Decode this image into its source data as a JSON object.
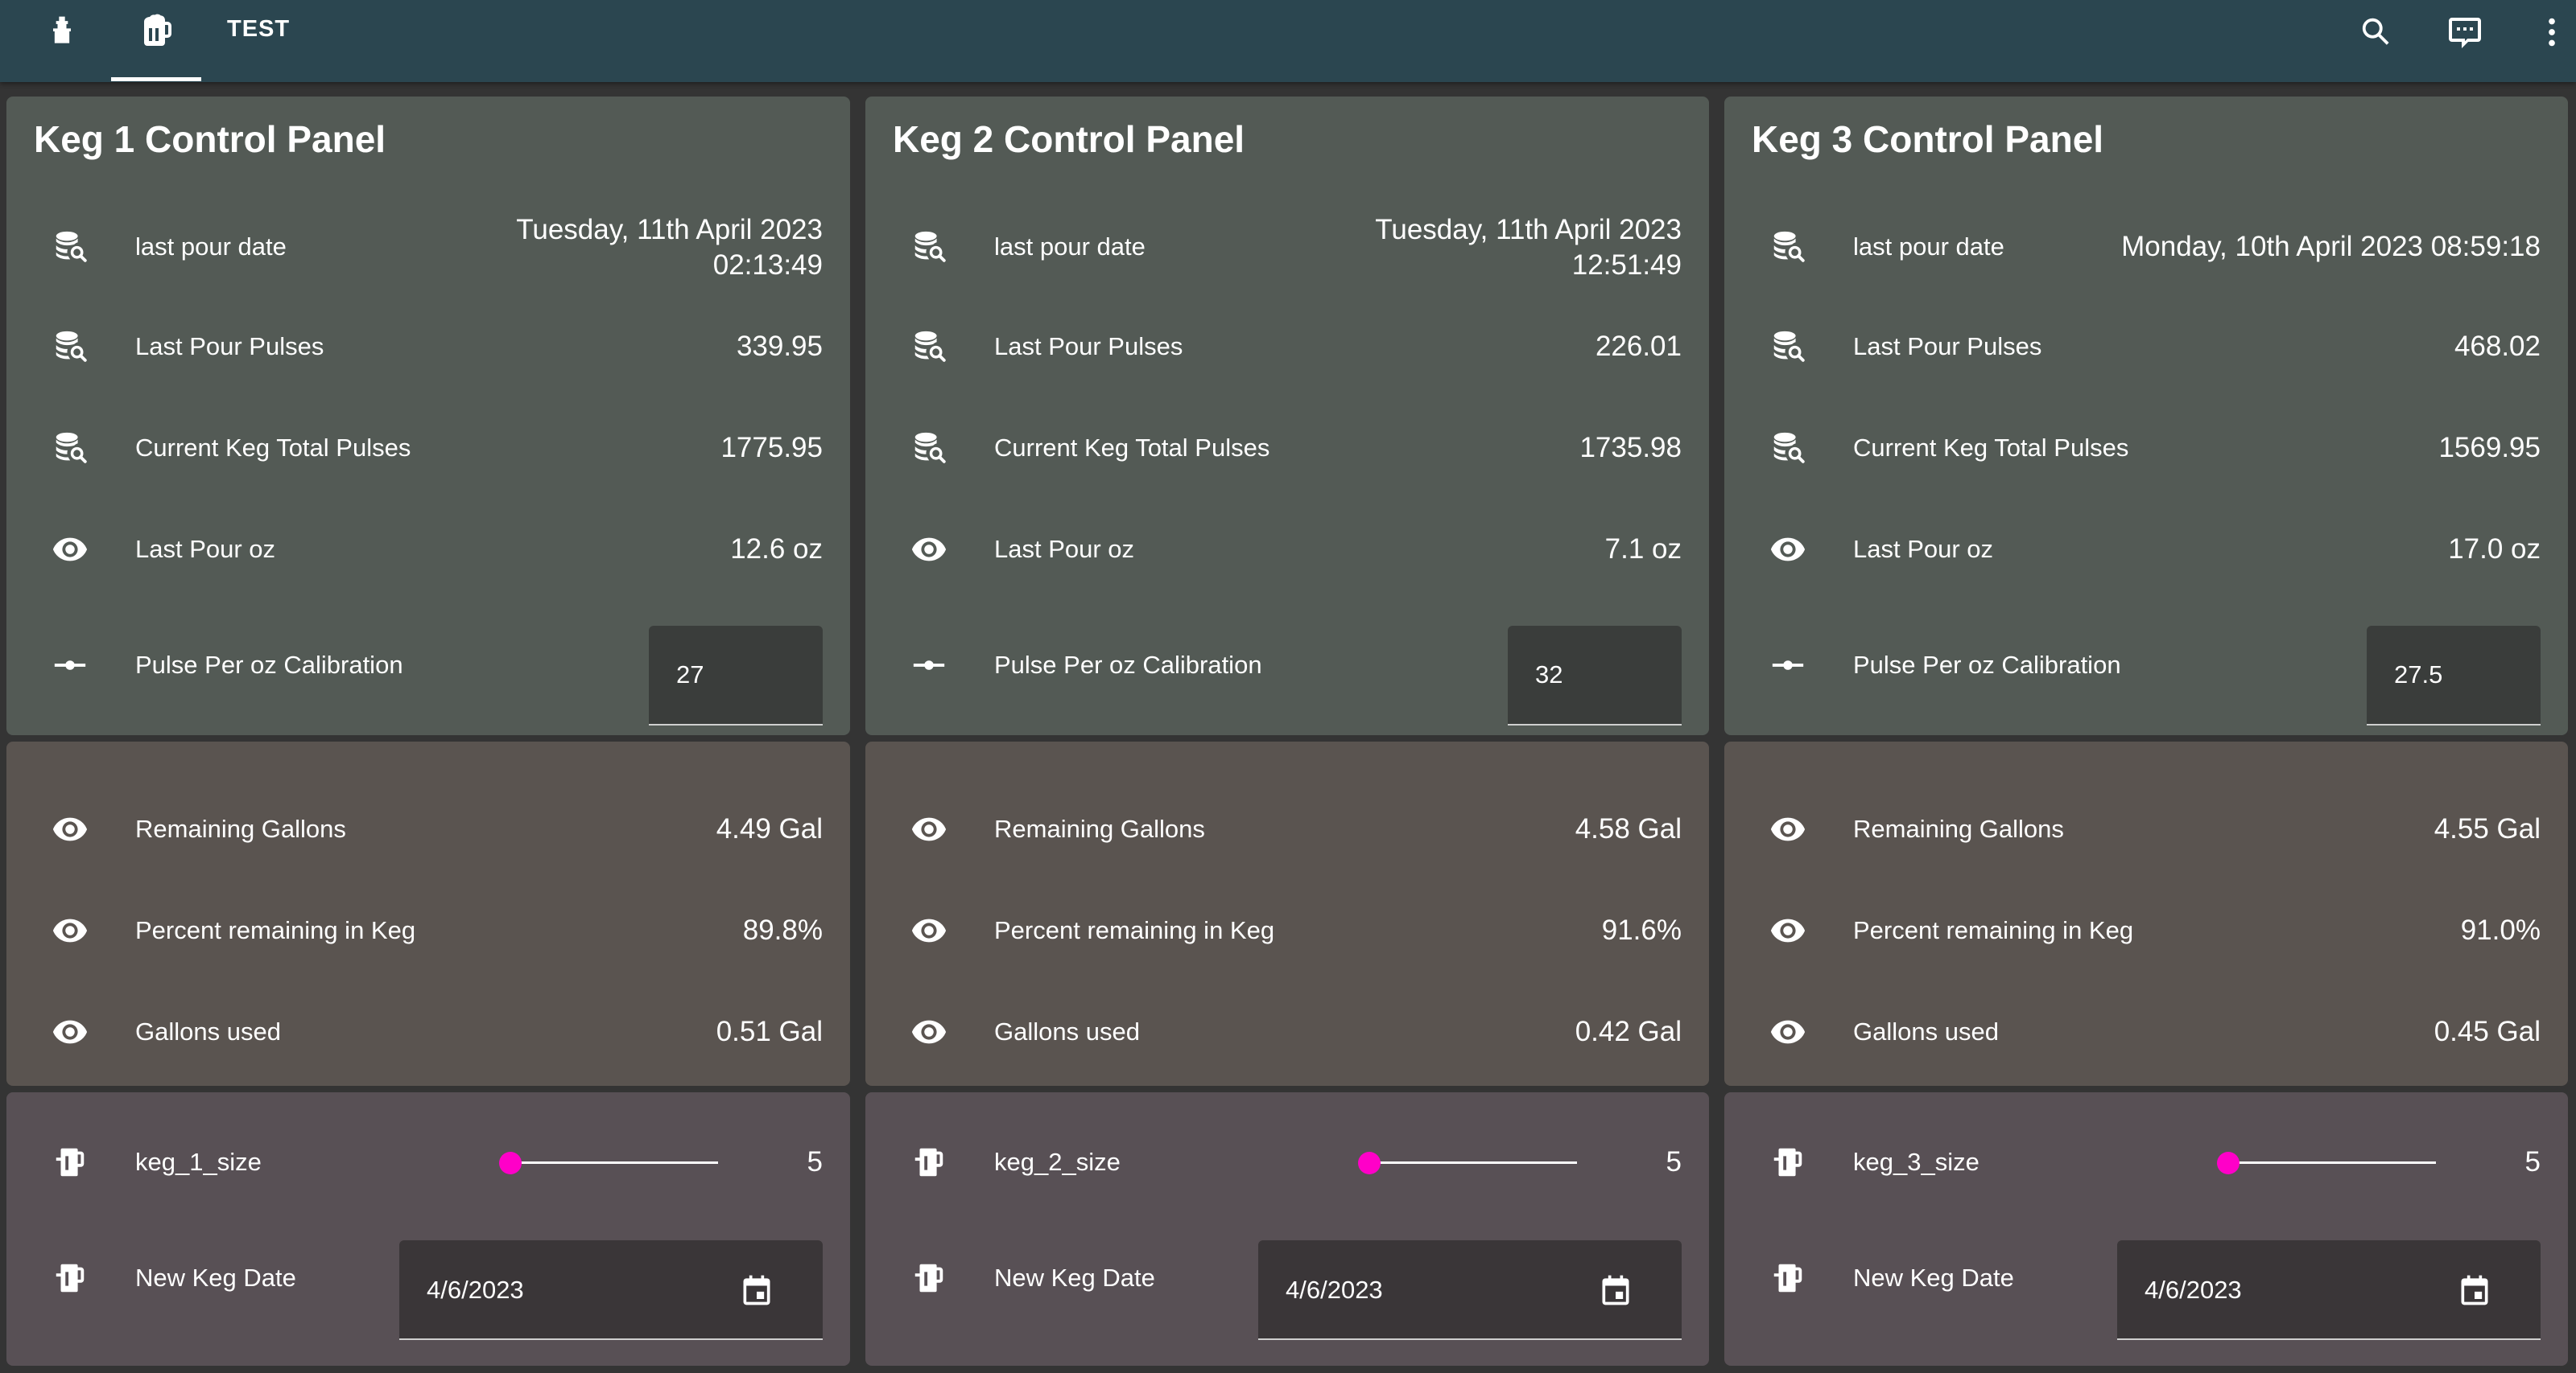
{
  "header": {
    "tab_label": "TEST",
    "icons": [
      "tool-icon",
      "beer-mug-icon"
    ],
    "actions": [
      "search-icon",
      "comment-text-icon",
      "dots-vertical-icon"
    ]
  },
  "colors": {
    "header_bg": "#2b4650",
    "card_green": "#535a55",
    "card_brown": "#5a5450",
    "card_mauve": "#585055",
    "slider_accent": "#ff00c8"
  },
  "kegs": [
    {
      "title": "Keg 1 Control Panel",
      "last_pour_date_label": "last pour date",
      "last_pour_date_line1": "Tuesday, 11th April 2023",
      "last_pour_date_line2": "02:13:49",
      "last_pour_pulses_label": "Last Pour Pulses",
      "last_pour_pulses": "339.95",
      "total_pulses_label": "Current Keg Total Pulses",
      "total_pulses": "1775.95",
      "last_pour_oz_label": "Last Pour oz",
      "last_pour_oz": "12.6 oz",
      "calibration_label": "Pulse Per oz Calibration",
      "calibration": "27",
      "remaining_gallons_label": "Remaining Gallons",
      "remaining_gallons": "4.49 Gal",
      "percent_remaining_label": "Percent remaining in Keg",
      "percent_remaining": "89.8%",
      "gallons_used_label": "Gallons used",
      "gallons_used": "0.51 Gal",
      "size_label": "keg_1_size",
      "size_value": "5",
      "size_fraction": 0.0,
      "new_keg_date_label": "New Keg Date",
      "new_keg_date": "4/6/2023"
    },
    {
      "title": "Keg 2 Control Panel",
      "last_pour_date_label": "last pour date",
      "last_pour_date_line1": "Tuesday, 11th April 2023",
      "last_pour_date_line2": "12:51:49",
      "last_pour_pulses_label": "Last Pour Pulses",
      "last_pour_pulses": "226.01",
      "total_pulses_label": "Current Keg Total Pulses",
      "total_pulses": "1735.98",
      "last_pour_oz_label": "Last Pour oz",
      "last_pour_oz": "7.1 oz",
      "calibration_label": "Pulse Per oz Calibration",
      "calibration": "32",
      "remaining_gallons_label": "Remaining Gallons",
      "remaining_gallons": "4.58 Gal",
      "percent_remaining_label": "Percent remaining in Keg",
      "percent_remaining": "91.6%",
      "gallons_used_label": "Gallons used",
      "gallons_used": "0.42 Gal",
      "size_label": "keg_2_size",
      "size_value": "5",
      "size_fraction": 0.0,
      "new_keg_date_label": "New Keg Date",
      "new_keg_date": "4/6/2023"
    },
    {
      "title": "Keg 3 Control Panel",
      "last_pour_date_label": "last pour date",
      "last_pour_date_line1": "Monday, 10th April 2023 08:59:18",
      "last_pour_date_line2": "",
      "last_pour_pulses_label": "Last Pour Pulses",
      "last_pour_pulses": "468.02",
      "total_pulses_label": "Current Keg Total Pulses",
      "total_pulses": "1569.95",
      "last_pour_oz_label": "Last Pour oz",
      "last_pour_oz": "17.0 oz",
      "calibration_label": "Pulse Per oz Calibration",
      "calibration": "27.5",
      "remaining_gallons_label": "Remaining Gallons",
      "remaining_gallons": "4.55 Gal",
      "percent_remaining_label": "Percent remaining in Keg",
      "percent_remaining": "91.0%",
      "gallons_used_label": "Gallons used",
      "gallons_used": "0.45 Gal",
      "size_label": "keg_3_size",
      "size_value": "5",
      "size_fraction": 0.0,
      "new_keg_date_label": "New Keg Date",
      "new_keg_date": "4/6/2023"
    }
  ]
}
